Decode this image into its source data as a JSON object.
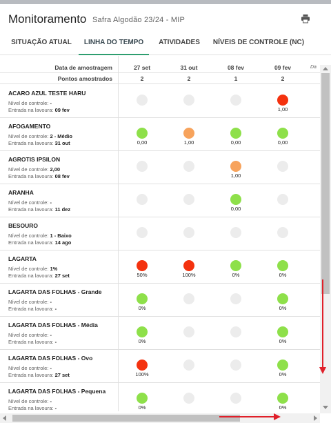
{
  "header": {
    "title": "Monitoramento",
    "subtitle": "Safra Algodão 23/24 - MIP",
    "print_icon": "printer-icon"
  },
  "tabs": [
    {
      "label": "SITUAÇÃO ATUAL",
      "active": false
    },
    {
      "label": "LINHA DO TEMPO",
      "active": true
    },
    {
      "label": "ATIVIDADES",
      "active": false
    },
    {
      "label": "NÍVEIS DE CONTROLE (NC)",
      "active": false
    }
  ],
  "table": {
    "date_label": "Data de amostragem",
    "points_label": "Pontos amostrados",
    "corner_text": "Da",
    "columns": [
      {
        "date": "27 set",
        "points": "2"
      },
      {
        "date": "31 out",
        "points": "2"
      },
      {
        "date": "08 fev",
        "points": "1"
      },
      {
        "date": "09 fev",
        "points": "2"
      }
    ],
    "level_prefix": "Nível de controle:",
    "entry_prefix": "Entrada na lavoura:",
    "rows": [
      {
        "name": "ACARO AZUL TESTE HARU",
        "level": "-",
        "entry": "09 fev",
        "cells": [
          {
            "color": "grey",
            "value": ""
          },
          {
            "color": "grey",
            "value": ""
          },
          {
            "color": "grey",
            "value": ""
          },
          {
            "color": "red",
            "value": "1,00"
          }
        ]
      },
      {
        "name": "AFOGAMENTO",
        "level": "2 - Médio",
        "entry": "31 out",
        "cells": [
          {
            "color": "green",
            "value": "0,00"
          },
          {
            "color": "orange",
            "value": "1,00"
          },
          {
            "color": "green",
            "value": "0,00"
          },
          {
            "color": "green",
            "value": "0,00"
          }
        ]
      },
      {
        "name": "AGROTIS IPSILON",
        "level": "2,00",
        "entry": "08 fev",
        "cells": [
          {
            "color": "grey",
            "value": ""
          },
          {
            "color": "grey",
            "value": ""
          },
          {
            "color": "orange",
            "value": "1,00"
          },
          {
            "color": "grey",
            "value": ""
          }
        ]
      },
      {
        "name": "ARANHA",
        "level": "-",
        "entry": "11 dez",
        "cells": [
          {
            "color": "grey",
            "value": ""
          },
          {
            "color": "grey",
            "value": ""
          },
          {
            "color": "green",
            "value": "0,00"
          },
          {
            "color": "grey",
            "value": ""
          }
        ]
      },
      {
        "name": "BESOURO",
        "level": "1 - Baixo",
        "entry": "14 ago",
        "cells": [
          {
            "color": "grey",
            "value": ""
          },
          {
            "color": "grey",
            "value": ""
          },
          {
            "color": "grey",
            "value": ""
          },
          {
            "color": "grey",
            "value": ""
          }
        ]
      },
      {
        "name": "LAGARTA",
        "level": "1%",
        "entry": "27 set",
        "cells": [
          {
            "color": "red",
            "value": "50%"
          },
          {
            "color": "red",
            "value": "100%"
          },
          {
            "color": "green",
            "value": "0%"
          },
          {
            "color": "green",
            "value": "0%"
          }
        ]
      },
      {
        "name": "LAGARTA DAS FOLHAS - Grande",
        "level": "-",
        "entry": "-",
        "cells": [
          {
            "color": "green",
            "value": "0%"
          },
          {
            "color": "grey",
            "value": ""
          },
          {
            "color": "grey",
            "value": ""
          },
          {
            "color": "green",
            "value": "0%"
          }
        ]
      },
      {
        "name": "LAGARTA DAS FOLHAS - Média",
        "level": "-",
        "entry": "-",
        "cells": [
          {
            "color": "green",
            "value": "0%"
          },
          {
            "color": "grey",
            "value": ""
          },
          {
            "color": "grey",
            "value": ""
          },
          {
            "color": "green",
            "value": "0%"
          }
        ]
      },
      {
        "name": "LAGARTA DAS FOLHAS - Ovo",
        "level": "-",
        "entry": "27 set",
        "cells": [
          {
            "color": "red",
            "value": "100%"
          },
          {
            "color": "grey",
            "value": ""
          },
          {
            "color": "grey",
            "value": ""
          },
          {
            "color": "green",
            "value": "0%"
          }
        ]
      },
      {
        "name": "LAGARTA DAS FOLHAS - Pequena",
        "level": "-",
        "entry": "-",
        "cells": [
          {
            "color": "green",
            "value": "0%"
          },
          {
            "color": "grey",
            "value": ""
          },
          {
            "color": "grey",
            "value": ""
          },
          {
            "color": "green",
            "value": "0%"
          }
        ]
      }
    ]
  },
  "colors": {
    "green": "#8ee04a",
    "orange": "#f7a35c",
    "red": "#f4320f",
    "grey": "#ececec",
    "tab_indicator": "#2e9e6f",
    "annotation_arrow": "#e0202a"
  }
}
